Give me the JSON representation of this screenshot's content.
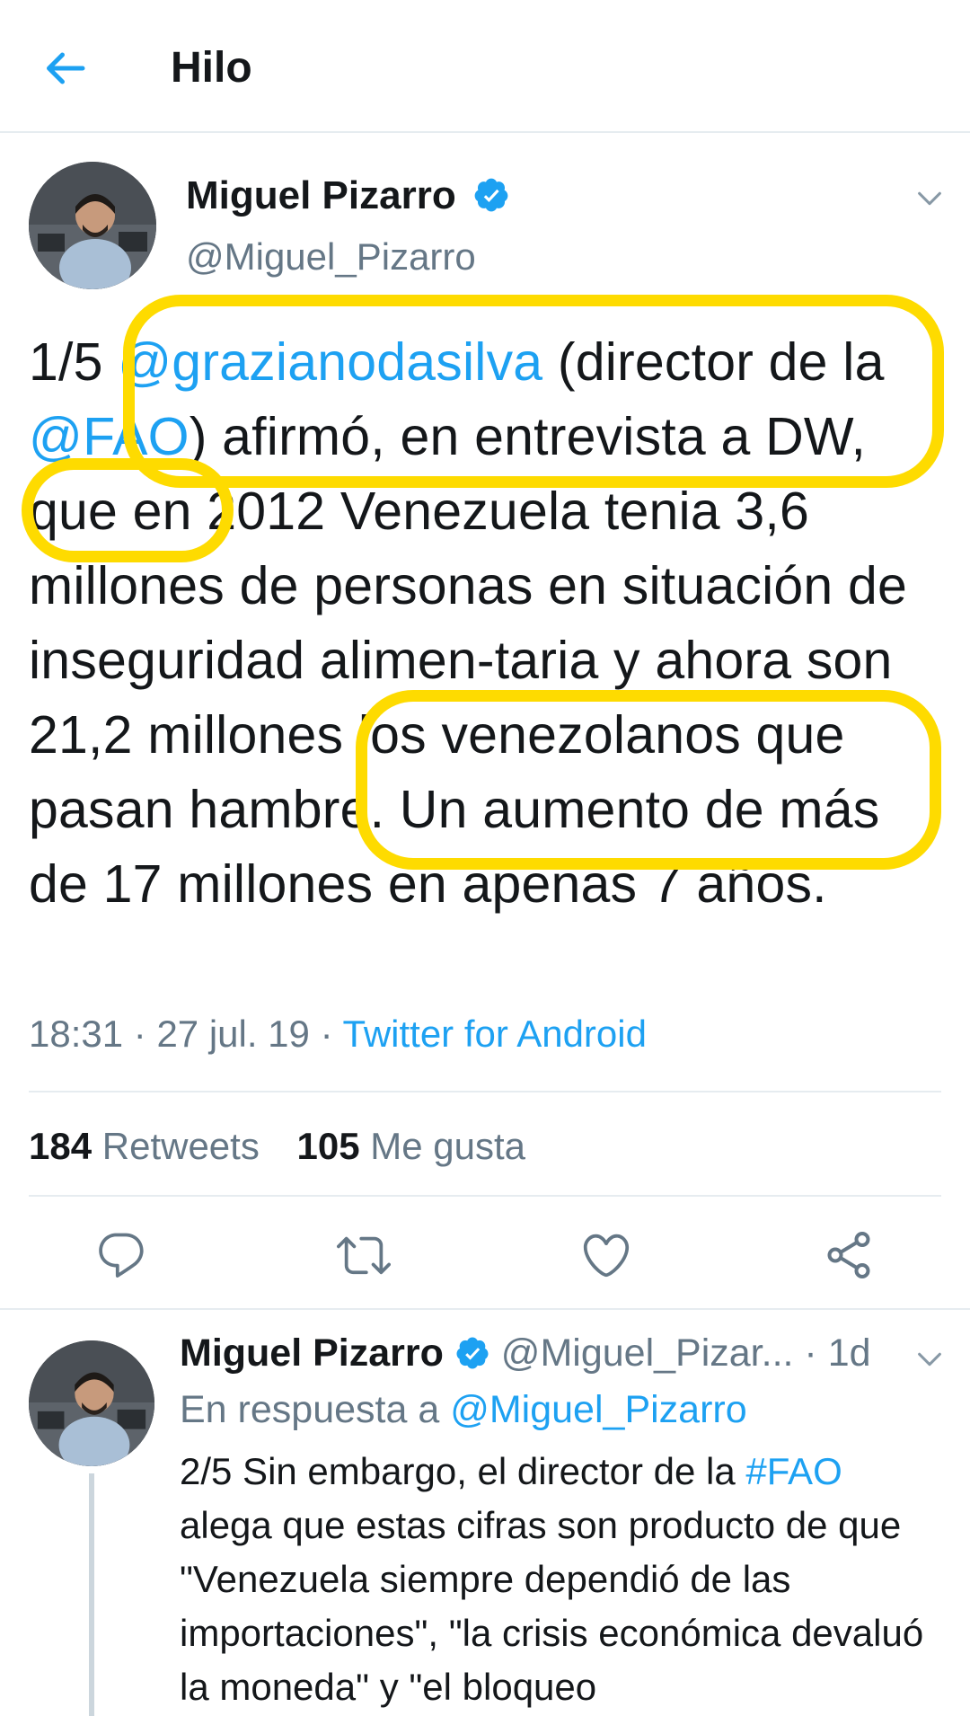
{
  "header": {
    "title": "Hilo",
    "back_icon": "arrow-left-icon"
  },
  "main_tweet": {
    "author_name": "Miguel Pizarro",
    "author_handle": "@Miguel_Pizarro",
    "verified_icon": "verified-badge-icon",
    "text_parts": {
      "p1": "1/5 ",
      "mention1": "@grazianodasilva",
      "p2": " (director de la ",
      "mention2": "@FAO",
      "p3": ") afirmó, en entrevista a DW, que en 2012 Venezuela tenia 3,6 millones de personas en situación de inseguridad alimen-taria y ahora son 21,2 millones los venezolanos que pasan hambre. Un aumento de más de 17 millones en apenas 7 años."
    },
    "time": "18:31",
    "date": "27 jul. 19",
    "separator": " · ",
    "source": "Twitter for Android",
    "retweets_count": "184",
    "retweets_label": "Retweets",
    "likes_count": "105",
    "likes_label": "Me gusta",
    "actions": [
      "reply-icon",
      "retweet-icon",
      "like-icon",
      "share-icon"
    ],
    "highlight_color": "#fedb00"
  },
  "reply_tweet": {
    "author_name": "Miguel Pizarro",
    "author_handle": "@Miguel_Pizar...",
    "time_ago": "· 1d",
    "reply_prefix": "En respuesta a ",
    "reply_to": "@Miguel_Pizarro",
    "text_p1": "2/5 Sin embargo, el director de la ",
    "hashtag": "#FAO",
    "text_p2": " alega que estas cifras son producto de que \"Venezuela siempre dependió de las importaciones\", \"la crisis económica devaluó la moneda\" y \"el bloqueo"
  },
  "colors": {
    "accent": "#1da1f2",
    "secondary_text": "#657786",
    "primary_text": "#14171a",
    "divider": "#e6ecf0"
  }
}
